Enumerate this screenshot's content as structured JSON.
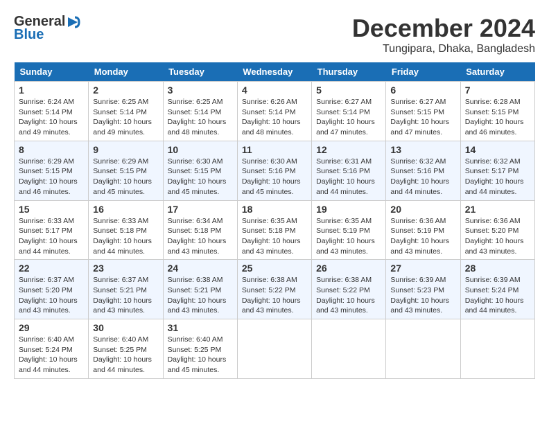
{
  "app": {
    "name": "GeneralBlue",
    "logo_icon": "▶"
  },
  "header": {
    "title": "December 2024",
    "subtitle": "Tungipara, Dhaka, Bangladesh"
  },
  "calendar": {
    "days_of_week": [
      "Sunday",
      "Monday",
      "Tuesday",
      "Wednesday",
      "Thursday",
      "Friday",
      "Saturday"
    ],
    "weeks": [
      [
        null,
        null,
        null,
        null,
        null,
        null,
        null
      ]
    ],
    "cells": [
      {
        "day": "1",
        "sunrise": "6:24 AM",
        "sunset": "5:14 PM",
        "daylight": "10 hours and 49 minutes."
      },
      {
        "day": "2",
        "sunrise": "6:25 AM",
        "sunset": "5:14 PM",
        "daylight": "10 hours and 49 minutes."
      },
      {
        "day": "3",
        "sunrise": "6:25 AM",
        "sunset": "5:14 PM",
        "daylight": "10 hours and 48 minutes."
      },
      {
        "day": "4",
        "sunrise": "6:26 AM",
        "sunset": "5:14 PM",
        "daylight": "10 hours and 48 minutes."
      },
      {
        "day": "5",
        "sunrise": "6:27 AM",
        "sunset": "5:14 PM",
        "daylight": "10 hours and 47 minutes."
      },
      {
        "day": "6",
        "sunrise": "6:27 AM",
        "sunset": "5:15 PM",
        "daylight": "10 hours and 47 minutes."
      },
      {
        "day": "7",
        "sunrise": "6:28 AM",
        "sunset": "5:15 PM",
        "daylight": "10 hours and 46 minutes."
      },
      {
        "day": "8",
        "sunrise": "6:29 AM",
        "sunset": "5:15 PM",
        "daylight": "10 hours and 46 minutes."
      },
      {
        "day": "9",
        "sunrise": "6:29 AM",
        "sunset": "5:15 PM",
        "daylight": "10 hours and 45 minutes."
      },
      {
        "day": "10",
        "sunrise": "6:30 AM",
        "sunset": "5:15 PM",
        "daylight": "10 hours and 45 minutes."
      },
      {
        "day": "11",
        "sunrise": "6:30 AM",
        "sunset": "5:16 PM",
        "daylight": "10 hours and 45 minutes."
      },
      {
        "day": "12",
        "sunrise": "6:31 AM",
        "sunset": "5:16 PM",
        "daylight": "10 hours and 44 minutes."
      },
      {
        "day": "13",
        "sunrise": "6:32 AM",
        "sunset": "5:16 PM",
        "daylight": "10 hours and 44 minutes."
      },
      {
        "day": "14",
        "sunrise": "6:32 AM",
        "sunset": "5:17 PM",
        "daylight": "10 hours and 44 minutes."
      },
      {
        "day": "15",
        "sunrise": "6:33 AM",
        "sunset": "5:17 PM",
        "daylight": "10 hours and 44 minutes."
      },
      {
        "day": "16",
        "sunrise": "6:33 AM",
        "sunset": "5:18 PM",
        "daylight": "10 hours and 44 minutes."
      },
      {
        "day": "17",
        "sunrise": "6:34 AM",
        "sunset": "5:18 PM",
        "daylight": "10 hours and 43 minutes."
      },
      {
        "day": "18",
        "sunrise": "6:35 AM",
        "sunset": "5:18 PM",
        "daylight": "10 hours and 43 minutes."
      },
      {
        "day": "19",
        "sunrise": "6:35 AM",
        "sunset": "5:19 PM",
        "daylight": "10 hours and 43 minutes."
      },
      {
        "day": "20",
        "sunrise": "6:36 AM",
        "sunset": "5:19 PM",
        "daylight": "10 hours and 43 minutes."
      },
      {
        "day": "21",
        "sunrise": "6:36 AM",
        "sunset": "5:20 PM",
        "daylight": "10 hours and 43 minutes."
      },
      {
        "day": "22",
        "sunrise": "6:37 AM",
        "sunset": "5:20 PM",
        "daylight": "10 hours and 43 minutes."
      },
      {
        "day": "23",
        "sunrise": "6:37 AM",
        "sunset": "5:21 PM",
        "daylight": "10 hours and 43 minutes."
      },
      {
        "day": "24",
        "sunrise": "6:38 AM",
        "sunset": "5:21 PM",
        "daylight": "10 hours and 43 minutes."
      },
      {
        "day": "25",
        "sunrise": "6:38 AM",
        "sunset": "5:22 PM",
        "daylight": "10 hours and 43 minutes."
      },
      {
        "day": "26",
        "sunrise": "6:38 AM",
        "sunset": "5:22 PM",
        "daylight": "10 hours and 43 minutes."
      },
      {
        "day": "27",
        "sunrise": "6:39 AM",
        "sunset": "5:23 PM",
        "daylight": "10 hours and 43 minutes."
      },
      {
        "day": "28",
        "sunrise": "6:39 AM",
        "sunset": "5:24 PM",
        "daylight": "10 hours and 44 minutes."
      },
      {
        "day": "29",
        "sunrise": "6:40 AM",
        "sunset": "5:24 PM",
        "daylight": "10 hours and 44 minutes."
      },
      {
        "day": "30",
        "sunrise": "6:40 AM",
        "sunset": "5:25 PM",
        "daylight": "10 hours and 44 minutes."
      },
      {
        "day": "31",
        "sunrise": "6:40 AM",
        "sunset": "5:25 PM",
        "daylight": "10 hours and 45 minutes."
      }
    ],
    "start_day_of_week": 0
  }
}
